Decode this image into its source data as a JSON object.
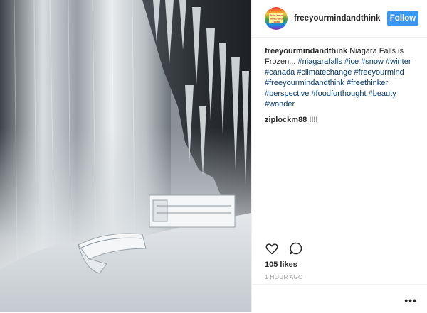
{
  "post": {
    "image_alt": "Frozen Niagara Falls with ice-covered observation platform",
    "header": {
      "username": "freeyourmindandthink",
      "follow_label": "Follow",
      "avatar_lines": [
        "Free Your",
        "Mind and",
        "Think"
      ]
    },
    "comments": [
      {
        "username": "freeyourmindandthink",
        "text": "Niagara Falls is Frozen...",
        "hashtags": [
          "#niagarafalls",
          "#ice",
          "#snow",
          "#winter",
          "#canada",
          "#climatechange",
          "#freeyourmind",
          "#freeyourmindandthink",
          "#freethinker",
          "#perspective",
          "#foodforthought",
          "#beauty",
          "#wonder"
        ]
      },
      {
        "username": "ziplockm88",
        "text": "!!!!",
        "hashtags": []
      }
    ],
    "likes": "105 likes",
    "timestamp": "1 HOUR AGO",
    "more_icon": "ellipsis-icon"
  },
  "colors": {
    "follow_button": "#3897f0",
    "hashtag": "#003569",
    "border": "#efefef",
    "timestamp": "#999999"
  }
}
